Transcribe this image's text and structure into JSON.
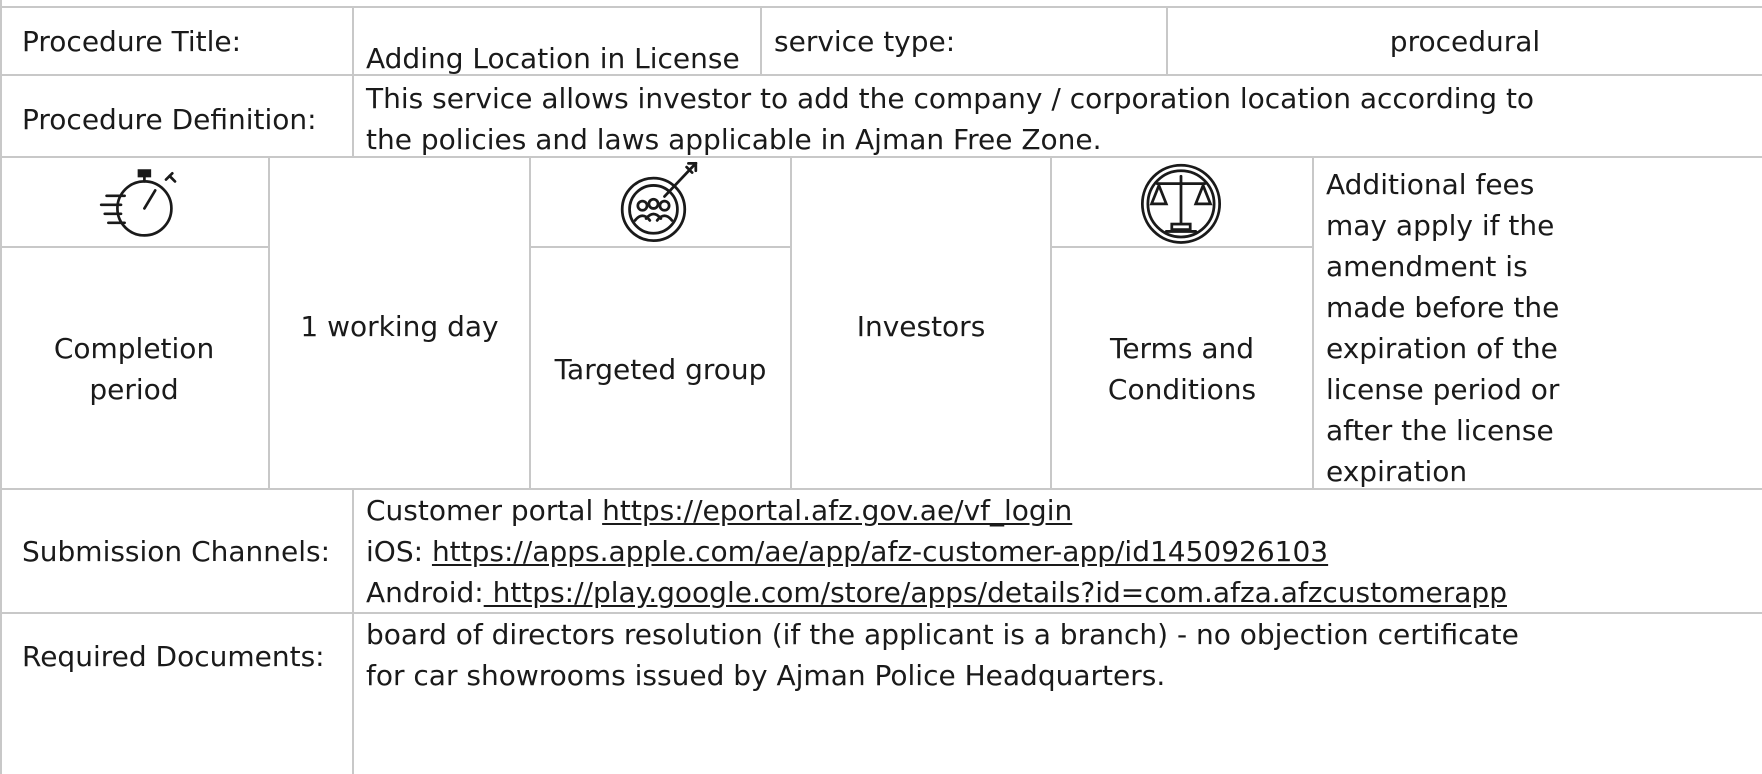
{
  "header": {
    "title_label": "Procedure Title:",
    "title_value": "Adding Location in License",
    "type_label": "service type:",
    "type_value": "procedural"
  },
  "definition": {
    "label": "Procedure Definition:",
    "text": [
      "This service allows investor to add the company / corporation location according to",
      "the policies and laws applicable in Ajman Free Zone."
    ]
  },
  "info": {
    "completion_label": [
      "Completion",
      "period"
    ],
    "completion_value": "1 working day",
    "group_label": "Targeted group",
    "group_value": "Investors",
    "terms_label": [
      "Terms and",
      "Conditions"
    ],
    "terms_value": [
      "Additional fees",
      "may apply if the",
      "amendment is",
      "made before the",
      "expiration of the",
      "license period or",
      "after the license",
      "expiration"
    ],
    "icons": [
      "stopwatch-icon",
      "target-group-icon",
      "scales-of-justice-icon"
    ]
  },
  "submission": {
    "label": "Submission Channels:",
    "portal_prefix": "Customer portal ",
    "portal_url": "https://eportal.afz.gov.ae/vf_login",
    "ios_prefix": "iOS: ",
    "ios_url": "https://apps.apple.com/ae/app/afz-customer-app/id1450926103",
    "android_prefix": "Android:",
    "android_url": " https://play.google.com/store/apps/details?id=com.afza.afzcustomerapp"
  },
  "documents": {
    "label": "Required Documents:",
    "text": [
      "board of directors resolution (if the applicant is a branch) - no objection certificate",
      "for car showrooms issued by Ajman Police Headquarters."
    ]
  }
}
